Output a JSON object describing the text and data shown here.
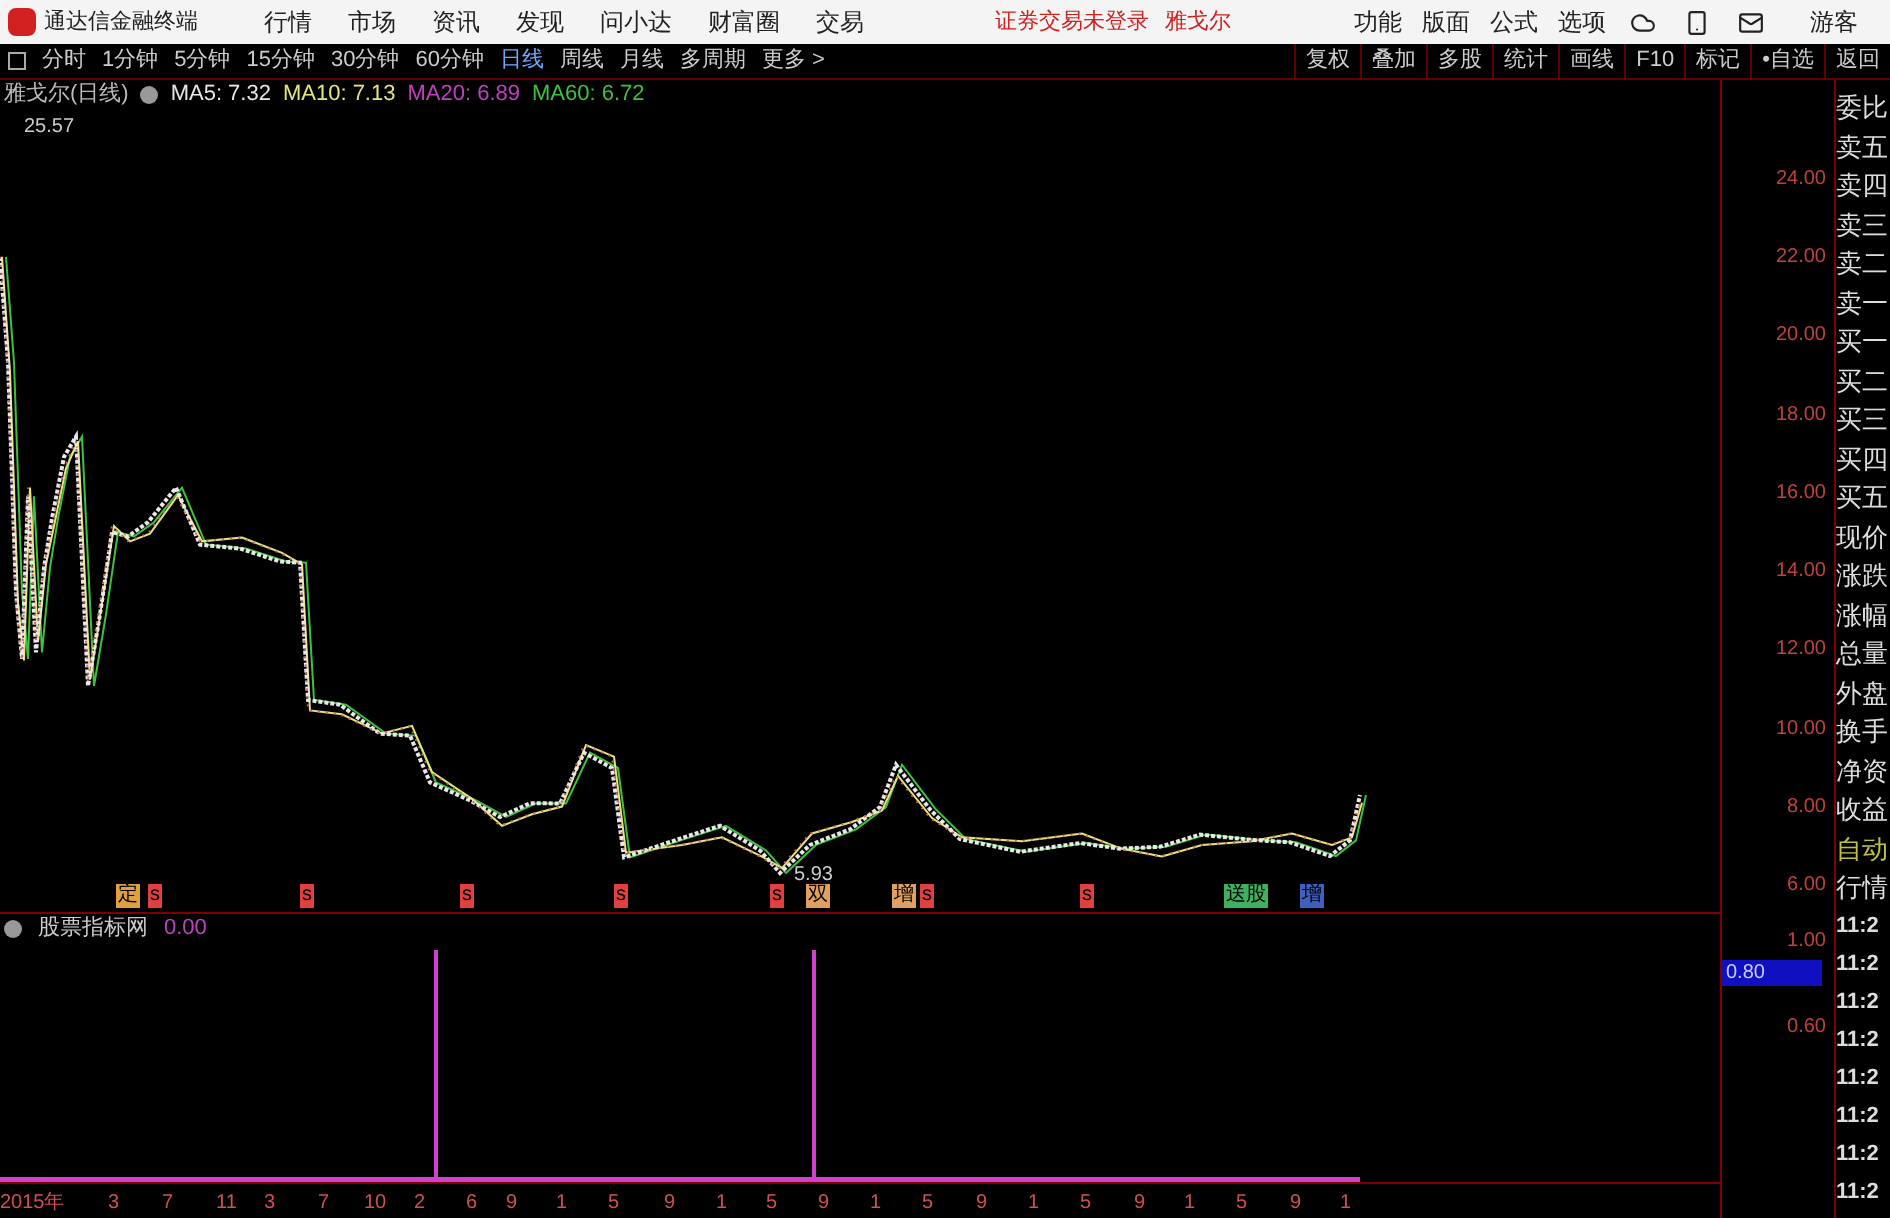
{
  "title_bar": {
    "app_title": "通达信金融终端",
    "menu": [
      "行情",
      "市场",
      "资讯",
      "发现",
      "问小达",
      "财富圈",
      "交易"
    ],
    "login_status": "证券交易未登录",
    "stock_name": "雅戈尔",
    "right_menu": [
      "功能",
      "版面",
      "公式",
      "选项"
    ],
    "user": "游客"
  },
  "toolbar": {
    "periods": [
      {
        "label": "分时",
        "selected": false
      },
      {
        "label": "1分钟",
        "selected": false
      },
      {
        "label": "5分钟",
        "selected": false
      },
      {
        "label": "15分钟",
        "selected": false
      },
      {
        "label": "30分钟",
        "selected": false
      },
      {
        "label": "60分钟",
        "selected": false
      },
      {
        "label": "日线",
        "selected": true
      },
      {
        "label": "周线",
        "selected": false
      },
      {
        "label": "月线",
        "selected": false
      },
      {
        "label": "多周期",
        "selected": false
      }
    ],
    "more": "更多 >",
    "actions": [
      "复权",
      "叠加",
      "多股",
      "统计",
      "画线",
      "F10",
      "标记",
      "•自选",
      "返回"
    ]
  },
  "chart": {
    "title": "雅戈尔(日线)",
    "ma": [
      {
        "label": "MA5: 7.32",
        "color": "#e8e8e8"
      },
      {
        "label": "MA10: 7.13",
        "color": "#e6e67a"
      },
      {
        "label": "MA20: 6.89",
        "color": "#c040c0"
      },
      {
        "label": "MA60: 6.72",
        "color": "#40c040"
      }
    ],
    "high_label": "25.57",
    "low_label": "5.93",
    "y_ticks": [
      "24.00",
      "22.00",
      "20.00",
      "18.00",
      "16.00",
      "14.00",
      "12.00",
      "10.00",
      "8.00",
      "6.00"
    ],
    "events": [
      {
        "label": "定",
        "color": "#e0a040"
      },
      {
        "label": "s",
        "color": "#e04040"
      },
      {
        "label": "s",
        "color": "#e04040"
      },
      {
        "label": "s",
        "color": "#e04040"
      },
      {
        "label": "s",
        "color": "#e04040"
      },
      {
        "label": "s",
        "color": "#e04040"
      },
      {
        "label": "双",
        "color": "#e0a060"
      },
      {
        "label": "增",
        "color": "#e0a060"
      },
      {
        "label": "s",
        "color": "#e04040"
      },
      {
        "label": "s",
        "color": "#e04040"
      },
      {
        "label": "送股",
        "color": "#40b060"
      },
      {
        "label": "增",
        "color": "#4060c0"
      }
    ]
  },
  "indicator": {
    "title": "股票指标网",
    "value": "0.00",
    "y_ticks": [
      "1.00",
      "0.60"
    ],
    "cursor_value": "0.80"
  },
  "x_axis": [
    "2015年",
    "3",
    "7",
    "11",
    "3",
    "7",
    "10",
    "2",
    "6",
    "9",
    "1",
    "5",
    "9",
    "1",
    "5",
    "9",
    "1",
    "5",
    "9",
    "1",
    "5",
    "9",
    "1",
    "5",
    "9",
    "1"
  ],
  "side_panel": {
    "quote_labels": [
      "委比",
      "卖五",
      "卖四",
      "卖三",
      "卖二",
      "卖一",
      "买一",
      "买二",
      "买三",
      "买四",
      "买五",
      "现价",
      "涨跌",
      "涨幅",
      "总量",
      "外盘",
      "换手",
      "净资",
      "收益"
    ],
    "mode_labels": [
      "自动",
      "行情"
    ],
    "times": [
      "11:2",
      "11:2",
      "11:2",
      "11:2",
      "11:2",
      "11:2",
      "11:2",
      "11:2"
    ]
  }
}
